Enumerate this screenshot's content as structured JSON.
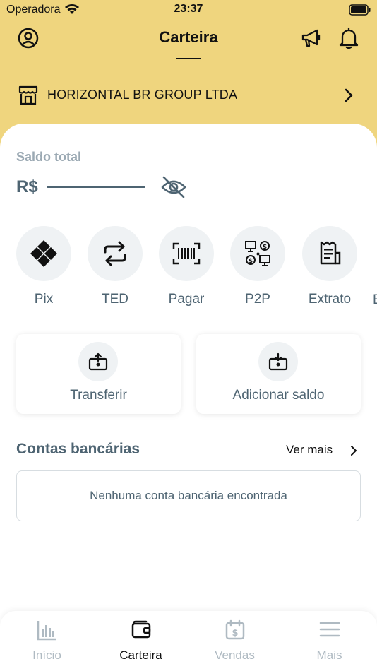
{
  "status_bar": {
    "carrier": "Operadora",
    "time": "23:37"
  },
  "header": {
    "title": "Carteira",
    "company_name": "HORIZONTAL BR GROUP LTDA"
  },
  "icons": {
    "profile": "user-circle-icon",
    "announcements": "megaphone-icon",
    "notifications": "bell-icon",
    "company": "store-icon",
    "company_chevron": "chevron-right-icon",
    "eye": "eye-off-icon"
  },
  "balance": {
    "label": "Saldo total",
    "currency": "R$"
  },
  "actions": [
    {
      "label": "Pix",
      "icon": "pix-icon"
    },
    {
      "label": "TED",
      "icon": "transfer-arrows-icon"
    },
    {
      "label": "Pagar",
      "icon": "barcode-icon"
    },
    {
      "label": "P2P",
      "icon": "p2p-icon"
    },
    {
      "label": "Extrato",
      "icon": "receipt-icon"
    }
  ],
  "actions_overflow_label": "E",
  "cards": [
    {
      "label": "Transferir",
      "icon": "money-upload-icon"
    },
    {
      "label": "Adicionar saldo",
      "icon": "money-download-icon"
    }
  ],
  "bank_accounts": {
    "title": "Contas bancárias",
    "see_more": "Ver mais",
    "empty_message": "Nenhuma conta bancária encontrada"
  },
  "tabbar": [
    {
      "label": "Início",
      "icon": "bar-chart-icon",
      "active": false
    },
    {
      "label": "Carteira",
      "icon": "wallet-icon",
      "active": true
    },
    {
      "label": "Vendas",
      "icon": "calendar-money-icon",
      "active": false
    },
    {
      "label": "Mais",
      "icon": "menu-icon",
      "active": false
    }
  ],
  "colors": {
    "header_bg": "#EFD57E",
    "text_muted": "#4E6472",
    "label_muted": "#9BA9B3",
    "circle_bg": "#EFF2F4",
    "tab_inactive": "#AFBAC2"
  }
}
